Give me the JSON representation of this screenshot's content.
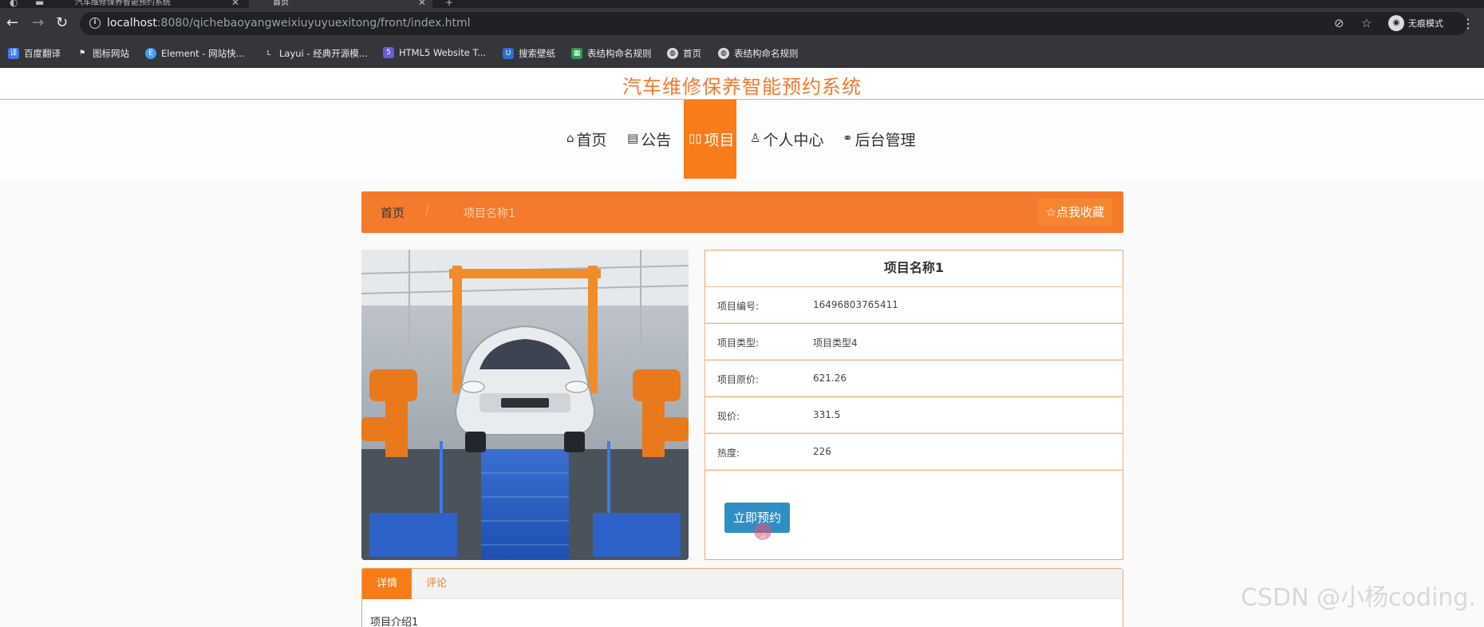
{
  "browser": {
    "tabs": [
      {
        "title": "汽车维修保养智能预约系统"
      },
      {
        "title": "首页"
      }
    ],
    "new_tab": "+",
    "url_host": "localhost",
    "url_rest": ":8080/qichebaoyangweixiuyuyuexitong/front/index.html",
    "incognito_label": "无痕模式",
    "bookmarks": [
      {
        "label": "百度翻译",
        "icon": "translate-icon",
        "color": "#3b7bf2"
      },
      {
        "label": "图标网站",
        "icon": "flag-icon",
        "color": "#333333"
      },
      {
        "label": "Element - 网站快...",
        "icon": "element-icon",
        "color": "#409eff"
      },
      {
        "label": "Layui - 经典开源模...",
        "icon": "layui-icon",
        "color": "#555555"
      },
      {
        "label": "HTML5 Website T...",
        "icon": "html5-icon",
        "color": "#6b5bd6"
      },
      {
        "label": "搜索壁纸",
        "icon": "wallpaper-icon",
        "color": "#2c6fd6"
      },
      {
        "label": "表结构命名规则",
        "icon": "table-icon",
        "color": "#2e9e4f"
      },
      {
        "label": "首页",
        "icon": "globe-icon",
        "color": "#dadce0"
      },
      {
        "label": "表结构命名规则",
        "icon": "globe-icon",
        "color": "#dadce0"
      }
    ]
  },
  "site": {
    "title": "汽车维修保养智能预约系统",
    "nav": [
      {
        "label": "首页",
        "icon": "home-icon",
        "active": false
      },
      {
        "label": "公告",
        "icon": "notice-icon",
        "active": false
      },
      {
        "label": "项目",
        "icon": "grid-icon",
        "active": true
      },
      {
        "label": "个人中心",
        "icon": "user-icon",
        "active": false
      },
      {
        "label": "后台管理",
        "icon": "link-icon",
        "active": false
      }
    ],
    "breadcrumb": {
      "home": "首页",
      "separator": "/",
      "current": "项目名称1"
    },
    "favorite_button": "点我收藏",
    "accent_color": "#f47a2c"
  },
  "project": {
    "title": "项目名称1",
    "rows": [
      {
        "key": "项目编号:",
        "value": "16496803765411"
      },
      {
        "key": "项目类型:",
        "value": "项目类型4"
      },
      {
        "key": "项目原价:",
        "value": "621.26"
      },
      {
        "key": "现价:",
        "value": "331.5"
      },
      {
        "key": "热度:",
        "value": "226"
      }
    ],
    "book_button": "立即预约"
  },
  "detail_tabs": {
    "tabs": [
      "详情",
      "评论"
    ],
    "body": "项目介绍1"
  },
  "watermark": "CSDN @小杨coding."
}
